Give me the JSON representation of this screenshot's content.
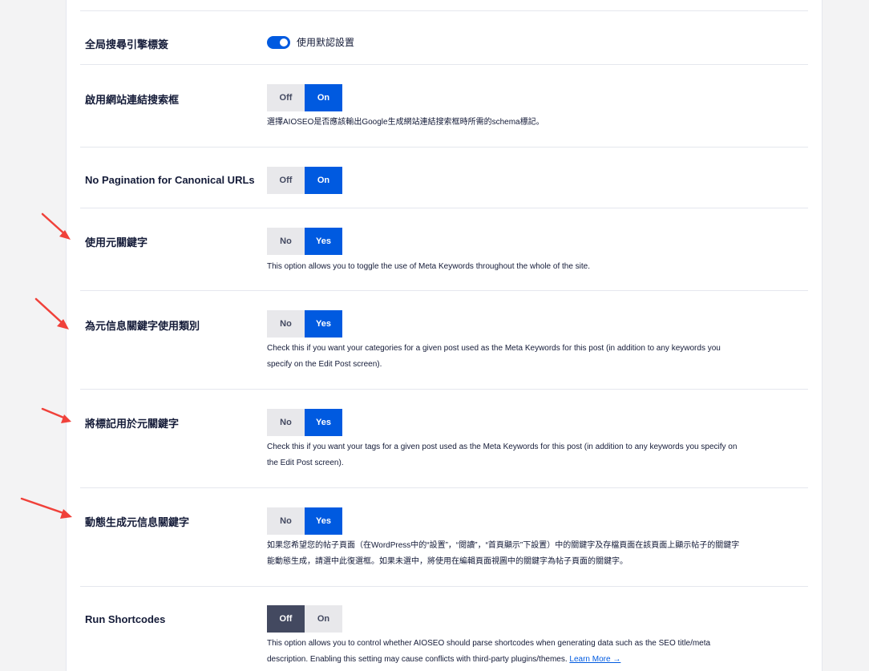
{
  "accent": "#005ae0",
  "annotation_color": "#f0413a",
  "settings": {
    "global_robots": {
      "label": "全局搜尋引擎標簽",
      "switch_label": "使用默認設置",
      "switch_on": true
    },
    "sitelinks": {
      "label": "啟用網站連結搜索框",
      "off": "Off",
      "on": "On",
      "selected": "On",
      "desc": "選擇AIOSEO是否應該輸出Google生成網站連結搜索框時所需的schema標記。"
    },
    "no_pagination": {
      "label": "No Pagination for Canonical URLs",
      "off": "Off",
      "on": "On",
      "selected": "On"
    },
    "meta_keywords": {
      "label": "使用元關鍵字",
      "no": "No",
      "yes": "Yes",
      "selected": "Yes",
      "desc": "This option allows you to toggle the use of Meta Keywords throughout the whole of the site."
    },
    "categories_keywords": {
      "label": "為元信息關鍵字使用類別",
      "no": "No",
      "yes": "Yes",
      "selected": "Yes",
      "desc_1": "Check this if you want your categories for a given post used as the Meta Keywords for this post (in addition to any keywords you",
      "desc_2": "specify on the Edit Post screen)."
    },
    "tags_keywords": {
      "label": "將標記用於元關鍵字",
      "no": "No",
      "yes": "Yes",
      "selected": "Yes",
      "desc_1": "Check this if you want your tags for a given post used as the Meta Keywords for this post (in addition to any keywords you specify on",
      "desc_2": "the Edit Post screen)."
    },
    "dynamic_keywords": {
      "label": "動態生成元信息關鍵字",
      "no": "No",
      "yes": "Yes",
      "selected": "Yes",
      "desc_1": "如果您希望您的帖子頁面（在WordPress中的“設置”，“閱讀”，“首頁顯示”下設置）中的關鍵字及存檔頁面在該頁面上顯示帖子的關鍵字",
      "desc_2": "能動態生成，請選中此復選框。如果未選中，將使用在編輯頁面視圖中的關鍵字為帖子頁面的關鍵字。"
    },
    "run_shortcodes": {
      "label": "Run Shortcodes",
      "off": "Off",
      "on": "On",
      "selected": "Off",
      "desc_1": "This option allows you to control whether AIOSEO should parse shortcodes when generating data such as the SEO title/meta",
      "desc_2": "description. Enabling this setting may cause conflicts with third-party plugins/themes.",
      "learn_more": "Learn More →"
    }
  },
  "icons": [
    "red-arrow-annotation-icon"
  ]
}
